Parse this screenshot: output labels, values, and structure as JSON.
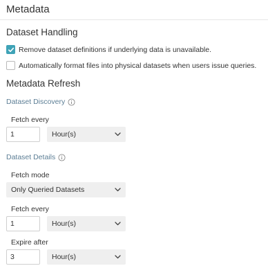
{
  "panel": {
    "title": "Metadata"
  },
  "dataset_handling": {
    "heading": "Dataset Handling",
    "options": [
      {
        "label": "Remove dataset definitions if underlying data is unavailable.",
        "checked": true
      },
      {
        "label": "Automatically format files into physical datasets when users issue queries.",
        "checked": false
      }
    ]
  },
  "metadata_refresh": {
    "heading": "Metadata Refresh",
    "dataset_discovery": {
      "title": "Dataset Discovery",
      "fetch_every_label": "Fetch every",
      "fetch_every_value": "1",
      "fetch_every_unit": "Hour(s)"
    },
    "dataset_details": {
      "title": "Dataset Details",
      "fetch_mode_label": "Fetch mode",
      "fetch_mode_value": "Only Queried Datasets",
      "fetch_every_label": "Fetch every",
      "fetch_every_value": "1",
      "fetch_every_unit": "Hour(s)",
      "expire_after_label": "Expire after",
      "expire_after_value": "3",
      "expire_after_unit": "Hour(s)"
    }
  },
  "colors": {
    "accent": "#3fa3b7",
    "subsection": "#5c7e95",
    "select_bg": "#efefef"
  },
  "icons": {
    "info": "info-icon",
    "dropdown": "chevron-down-icon",
    "check": "check-icon"
  }
}
